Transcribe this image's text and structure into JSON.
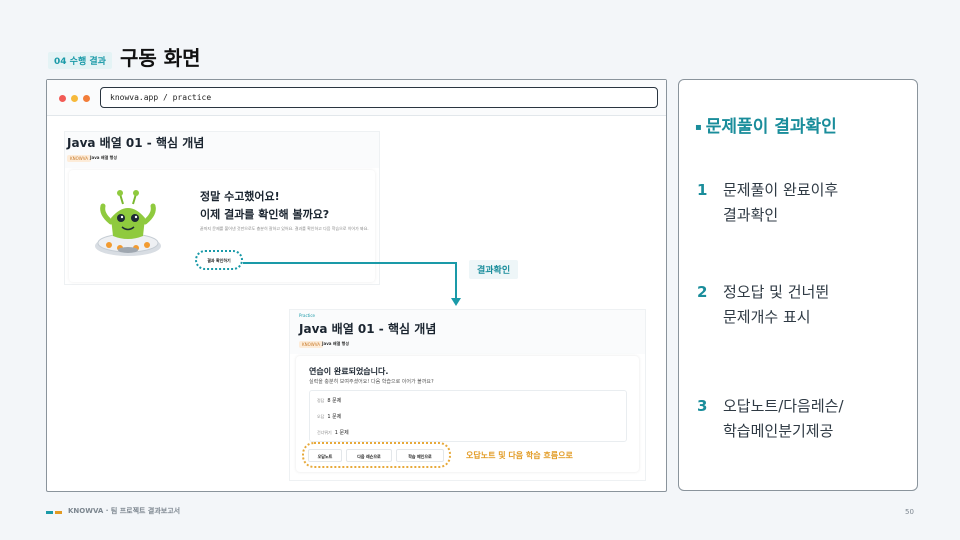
{
  "header": {
    "section_tag": "04 수행 결과",
    "title": "구동 화면"
  },
  "browser": {
    "url": "knowva.app / practice"
  },
  "screen1": {
    "title": "Java 배열 01 - 핵심 개념",
    "badge": "KNOWVA",
    "subtitle": "Java 배열 행성",
    "heading_line1": "정말 수고했어요!",
    "heading_line2": "이제 결과를 확인해 볼까요?",
    "description": "끝까지 문제를 풀어낸 것만으로도 충분히 잘하고 있어요. 결과를 확인하고 다음 학습으로 이어가 봐요.",
    "button": "결과 확인하기"
  },
  "arrow_label": "결과확인",
  "screen2": {
    "practice_tag": "Practice",
    "title": "Java 배열 01 - 핵심 개념",
    "badge": "KNOWVA",
    "subtitle": "Java 배열 행성",
    "done_title": "연습이 완료되었습니다.",
    "done_sub": "실력을 충분히 보여주셨어요! 다음 학습으로 이어가 볼까요?",
    "stats": [
      {
        "label": "정답",
        "value": "8 문제"
      },
      {
        "label": "오답",
        "value": "1 문제"
      },
      {
        "label": "건너뛰기",
        "value": "1 문제"
      }
    ],
    "buttons": [
      "오답노트",
      "다음 레슨으로",
      "학습 메인으로"
    ],
    "flow_label": "오답노트 및 다음 학습 흐름으로"
  },
  "panel": {
    "title": "문제풀이 결과확인",
    "items": [
      {
        "num": "1",
        "line1": "문제풀이 완료이후",
        "line2": "결과확인"
      },
      {
        "num": "2",
        "line1": "정오답 및 건너뛴",
        "line2": "문제개수 표시"
      },
      {
        "num": "3",
        "line1": "오답노트/다음레슨/",
        "line2": "학습메인분기제공"
      }
    ]
  },
  "footer": {
    "text": "KNOWVA · 팀 프로젝트 결과보고서",
    "page": "50"
  },
  "colors": {
    "accent_teal": "#1a9aa8",
    "accent_orange": "#e29a22"
  }
}
